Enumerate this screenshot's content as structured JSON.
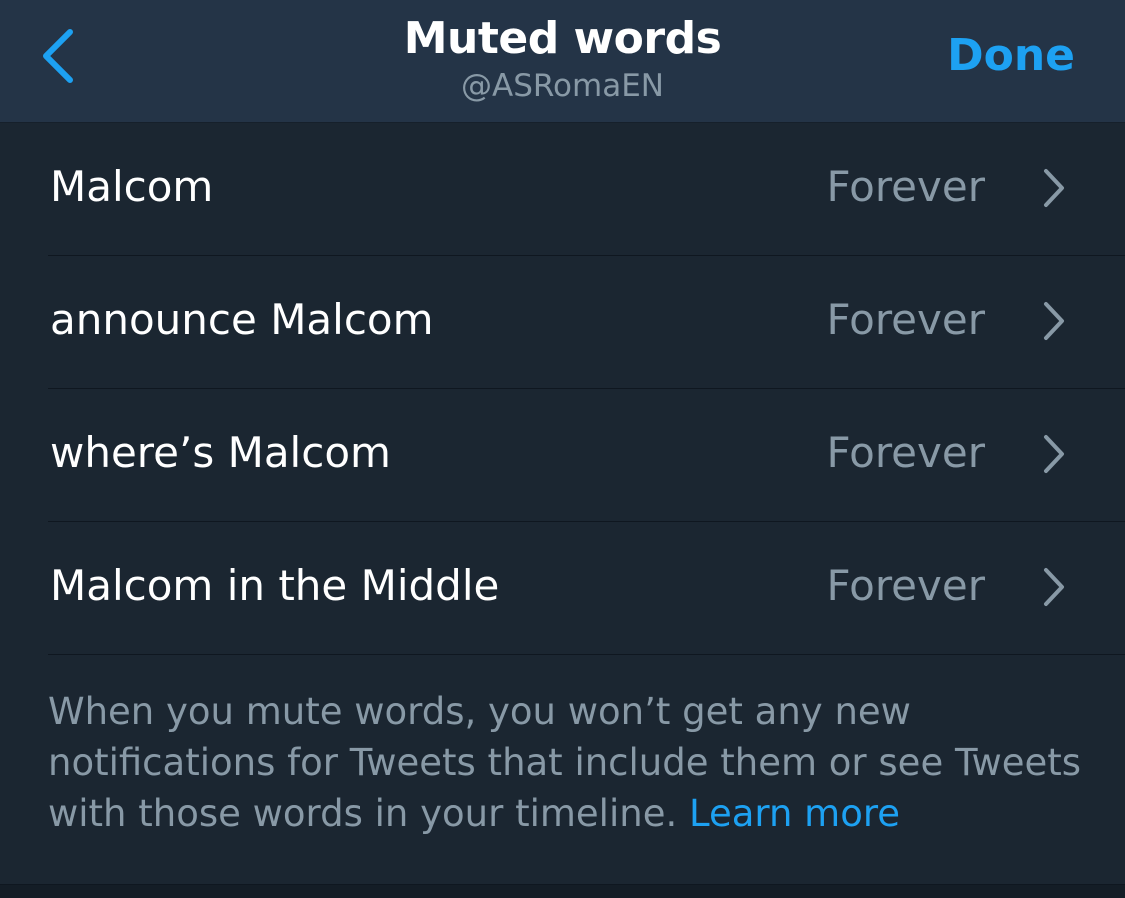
{
  "header": {
    "title": "Muted words",
    "subtitle": "@ASRomaEN",
    "done_label": "Done"
  },
  "muted_words": [
    {
      "word": "Malcom",
      "duration": "Forever"
    },
    {
      "word": "announce Malcom",
      "duration": "Forever"
    },
    {
      "word": "where’s Malcom",
      "duration": "Forever"
    },
    {
      "word": "Malcom in the Middle",
      "duration": "Forever"
    }
  ],
  "footer": {
    "text": "When you mute words, you won’t get any new notifications for Tweets that include them or see Tweets with those words in your timeline.",
    "learn_more": "Learn more"
  },
  "colors": {
    "background": "#1b2631",
    "navbar": "#243447",
    "accent": "#1da1f2",
    "secondary_text": "#8899a6"
  }
}
